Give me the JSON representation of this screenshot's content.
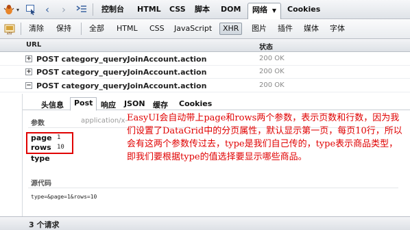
{
  "toolbar": {
    "tabs": [
      "控制台",
      "HTML",
      "CSS",
      "脚本",
      "DOM",
      "网络",
      "Cookies"
    ],
    "active_tab": "网络",
    "icons": [
      "firebug-icon",
      "inspect-icon",
      "back-icon",
      "forward-icon",
      "command-line-icon",
      "dropdown-arrow-icon"
    ]
  },
  "filter_bar": {
    "clear": "清除",
    "persist": "保持",
    "filters": [
      "全部",
      "HTML",
      "CSS",
      "JavaScript",
      "XHR",
      "图片",
      "插件",
      "媒体",
      "字体"
    ],
    "active_filter": "XHR"
  },
  "table": {
    "col_url": "URL",
    "col_status": "状态",
    "rows": [
      {
        "label": "POST category_queryJoinAccount.action",
        "status": "200 OK",
        "expanded": false
      },
      {
        "label": "POST category_queryJoinAccount.action",
        "status": "200 OK",
        "expanded": false
      },
      {
        "label": "POST category_queryJoinAccount.action",
        "status": "200 OK",
        "expanded": true
      }
    ]
  },
  "detail": {
    "tabs": [
      "头信息",
      "Post",
      "响应",
      "JSON",
      "缓存",
      "Cookies"
    ],
    "active_tab": "Post",
    "params_title": "参数",
    "content_type": "application/x-",
    "params": [
      {
        "name": "page",
        "value": "1"
      },
      {
        "name": "rows",
        "value": "10"
      },
      {
        "name": "type",
        "value": ""
      }
    ],
    "source_title": "源代码",
    "source": "type=&page=1&rows=10"
  },
  "annotation": "EasyUI会自动带上page和rows两个参数，表示页数和行数，因为我们设置了DataGrid中的分页属性，默认显示第一页，每页10行，所以会有这两个参数传过去，type是我们自己传的，type表示商品类型，即我们要根据type的值选择要显示哪些商品。",
  "footer": {
    "request_count": "3 个请求"
  }
}
